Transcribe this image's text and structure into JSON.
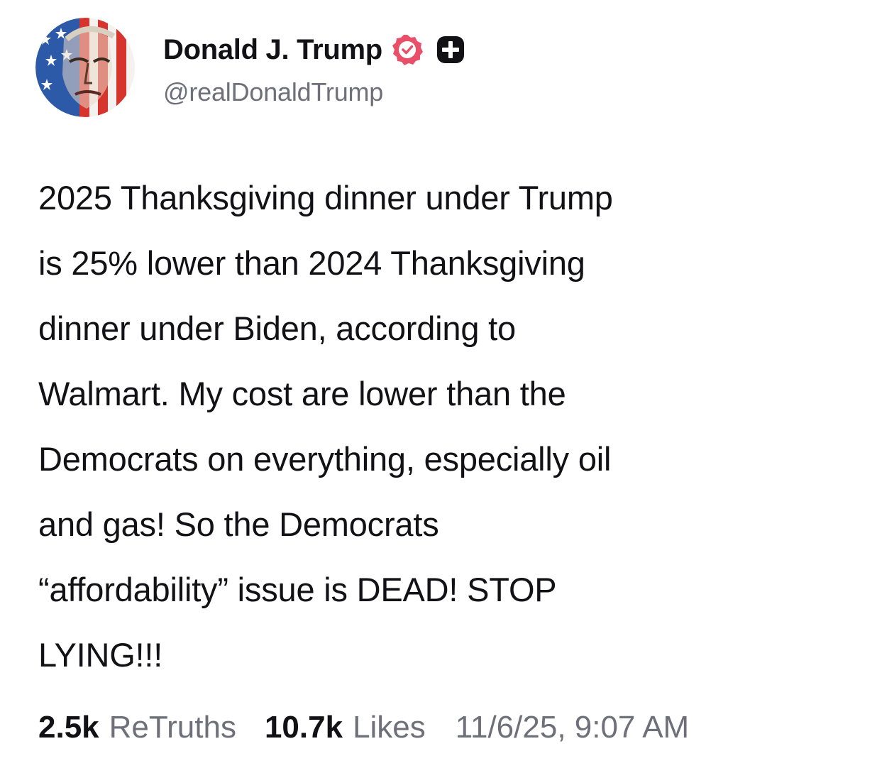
{
  "account": {
    "display_name": "Donald J. Trump",
    "handle": "@realDonaldTrump",
    "verified_badge_icon": "verified-badge-icon",
    "plus_badge_icon": "plus-badge-icon"
  },
  "post": {
    "lines": [
      "2025 Thanksgiving dinner under Trump",
      "is 25% lower than 2024 Thanksgiving",
      "dinner under Biden, according to",
      "Walmart. My cost are lower than the",
      "Democrats on everything, especially oil",
      "and gas! So the Democrats",
      "“affordability” issue is DEAD! STOP",
      "LYING!!!"
    ]
  },
  "stats": {
    "retruths_count": "2.5k",
    "retruths_label": "ReTruths",
    "likes_count": "10.7k",
    "likes_label": "Likes",
    "timestamp": "11/6/25, 9:07 AM"
  },
  "colors": {
    "verified_badge": "#e8506a",
    "text_primary": "#111116",
    "text_secondary": "#6f6f7a"
  }
}
